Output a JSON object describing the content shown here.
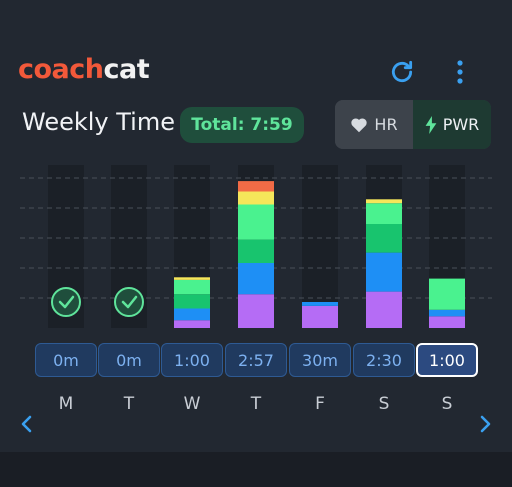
{
  "app": {
    "logo_part1": "coach",
    "logo_part2": "cat"
  },
  "header": {
    "title": "Weekly Time",
    "total": "Total: 7:59"
  },
  "toggle": {
    "hr_label": "HR",
    "pwr_label": "PWR",
    "selected": "PWR"
  },
  "days": [
    {
      "letter": "M",
      "time": "0m",
      "done": true,
      "segments": []
    },
    {
      "letter": "T",
      "time": "0m",
      "done": true,
      "segments": []
    },
    {
      "letter": "W",
      "time": "1:00",
      "done": false,
      "segments": [
        {
          "color": "#b56cf5",
          "v": 0.3
        },
        {
          "color": "#1e8ff5",
          "v": 0.45
        },
        {
          "color": "#18c46e",
          "v": 0.55
        },
        {
          "color": "#4af28f",
          "v": 0.55
        },
        {
          "color": "#f5e65a",
          "v": 0.1
        }
      ]
    },
    {
      "letter": "T",
      "time": "2:57",
      "done": false,
      "segments": [
        {
          "color": "#b56cf5",
          "v": 1.3
        },
        {
          "color": "#1e8ff5",
          "v": 1.2
        },
        {
          "color": "#18c46e",
          "v": 0.9
        },
        {
          "color": "#4af28f",
          "v": 1.35
        },
        {
          "color": "#f5e65a",
          "v": 0.5
        },
        {
          "color": "#f26b46",
          "v": 0.4
        }
      ]
    },
    {
      "letter": "F",
      "time": "30m",
      "done": false,
      "segments": [
        {
          "color": "#b56cf5",
          "v": 0.85
        },
        {
          "color": "#1e8ff5",
          "v": 0.15
        }
      ]
    },
    {
      "letter": "S",
      "time": "2:30",
      "done": false,
      "segments": [
        {
          "color": "#b56cf5",
          "v": 1.4
        },
        {
          "color": "#1e8ff5",
          "v": 1.5
        },
        {
          "color": "#18c46e",
          "v": 1.1
        },
        {
          "color": "#4af28f",
          "v": 0.8
        },
        {
          "color": "#f5e65a",
          "v": 0.15
        }
      ]
    },
    {
      "letter": "S",
      "time": "1:00",
      "done": false,
      "selected": true,
      "segments": [
        {
          "color": "#b56cf5",
          "v": 0.45
        },
        {
          "color": "#1e8ff5",
          "v": 0.25
        },
        {
          "color": "#4af28f",
          "v": 1.2
        }
      ]
    }
  ],
  "colors": {
    "accent_blue": "#3aa0f0",
    "green": "#5fe49b",
    "brand_orange": "#f2593a"
  }
}
